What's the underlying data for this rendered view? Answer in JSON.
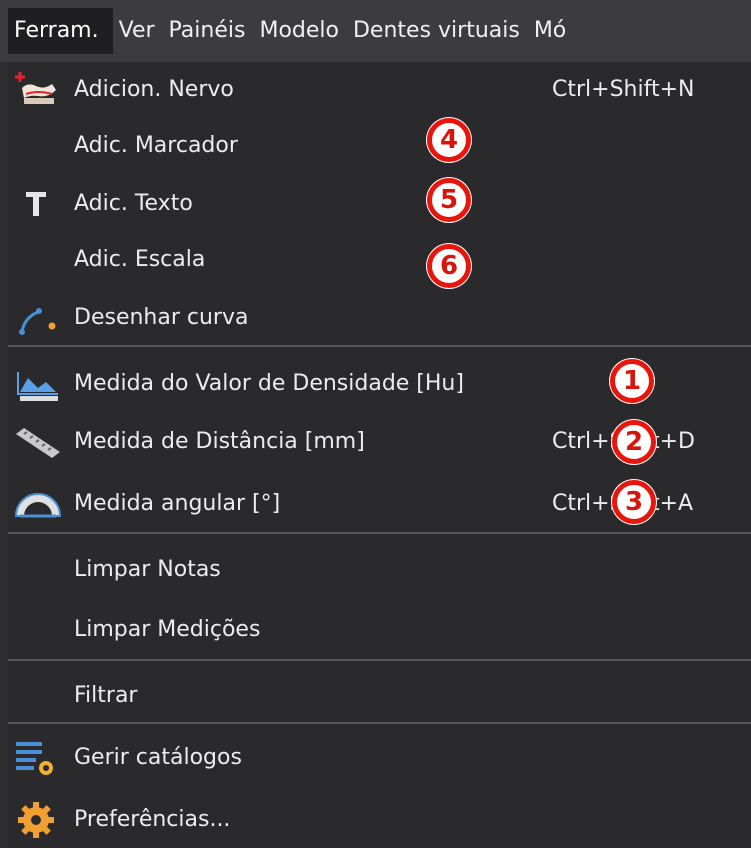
{
  "menubar": {
    "items": [
      "Ferram.",
      "Ver",
      "Painéis",
      "Modelo",
      "Dentes virtuais",
      "Mó"
    ]
  },
  "menu": {
    "items": [
      {
        "label": "Adicion. Nervo",
        "shortcut": "Ctrl+Shift+N",
        "icon": "nerve-icon"
      },
      {
        "label": "Adic. Marcador",
        "shortcut": "",
        "icon": ""
      },
      {
        "label": "Adic. Texto",
        "shortcut": "",
        "icon": "text-T-icon"
      },
      {
        "label": "Adic. Escala",
        "shortcut": "",
        "icon": ""
      },
      {
        "label": "Desenhar curva",
        "shortcut": "",
        "icon": "curve-icon"
      },
      {
        "label": "Medida do Valor de Densidade [Hu]",
        "shortcut": "",
        "icon": "density-icon"
      },
      {
        "label": "Medida de Distância [mm]",
        "shortcut": "Ctrl+Shift+D",
        "icon": "ruler-icon"
      },
      {
        "label": "Medida angular [°]",
        "shortcut": "Ctrl+Shift+A",
        "icon": "protractor-icon"
      },
      {
        "label": "Limpar Notas",
        "shortcut": "",
        "icon": ""
      },
      {
        "label": "Limpar Medições",
        "shortcut": "",
        "icon": ""
      },
      {
        "label": "Filtrar",
        "shortcut": "",
        "icon": ""
      },
      {
        "label": "Gerir catálogos",
        "shortcut": "",
        "icon": "catalog-icon"
      },
      {
        "label": "Preferências...",
        "shortcut": "",
        "icon": "gear-icon"
      }
    ]
  },
  "badges": [
    "1",
    "2",
    "3",
    "4",
    "5",
    "6"
  ],
  "colors": {
    "badge_border": "#e8150d",
    "menu_bg": "#2a2a2d",
    "menubar_bg": "#3c3c3f"
  }
}
